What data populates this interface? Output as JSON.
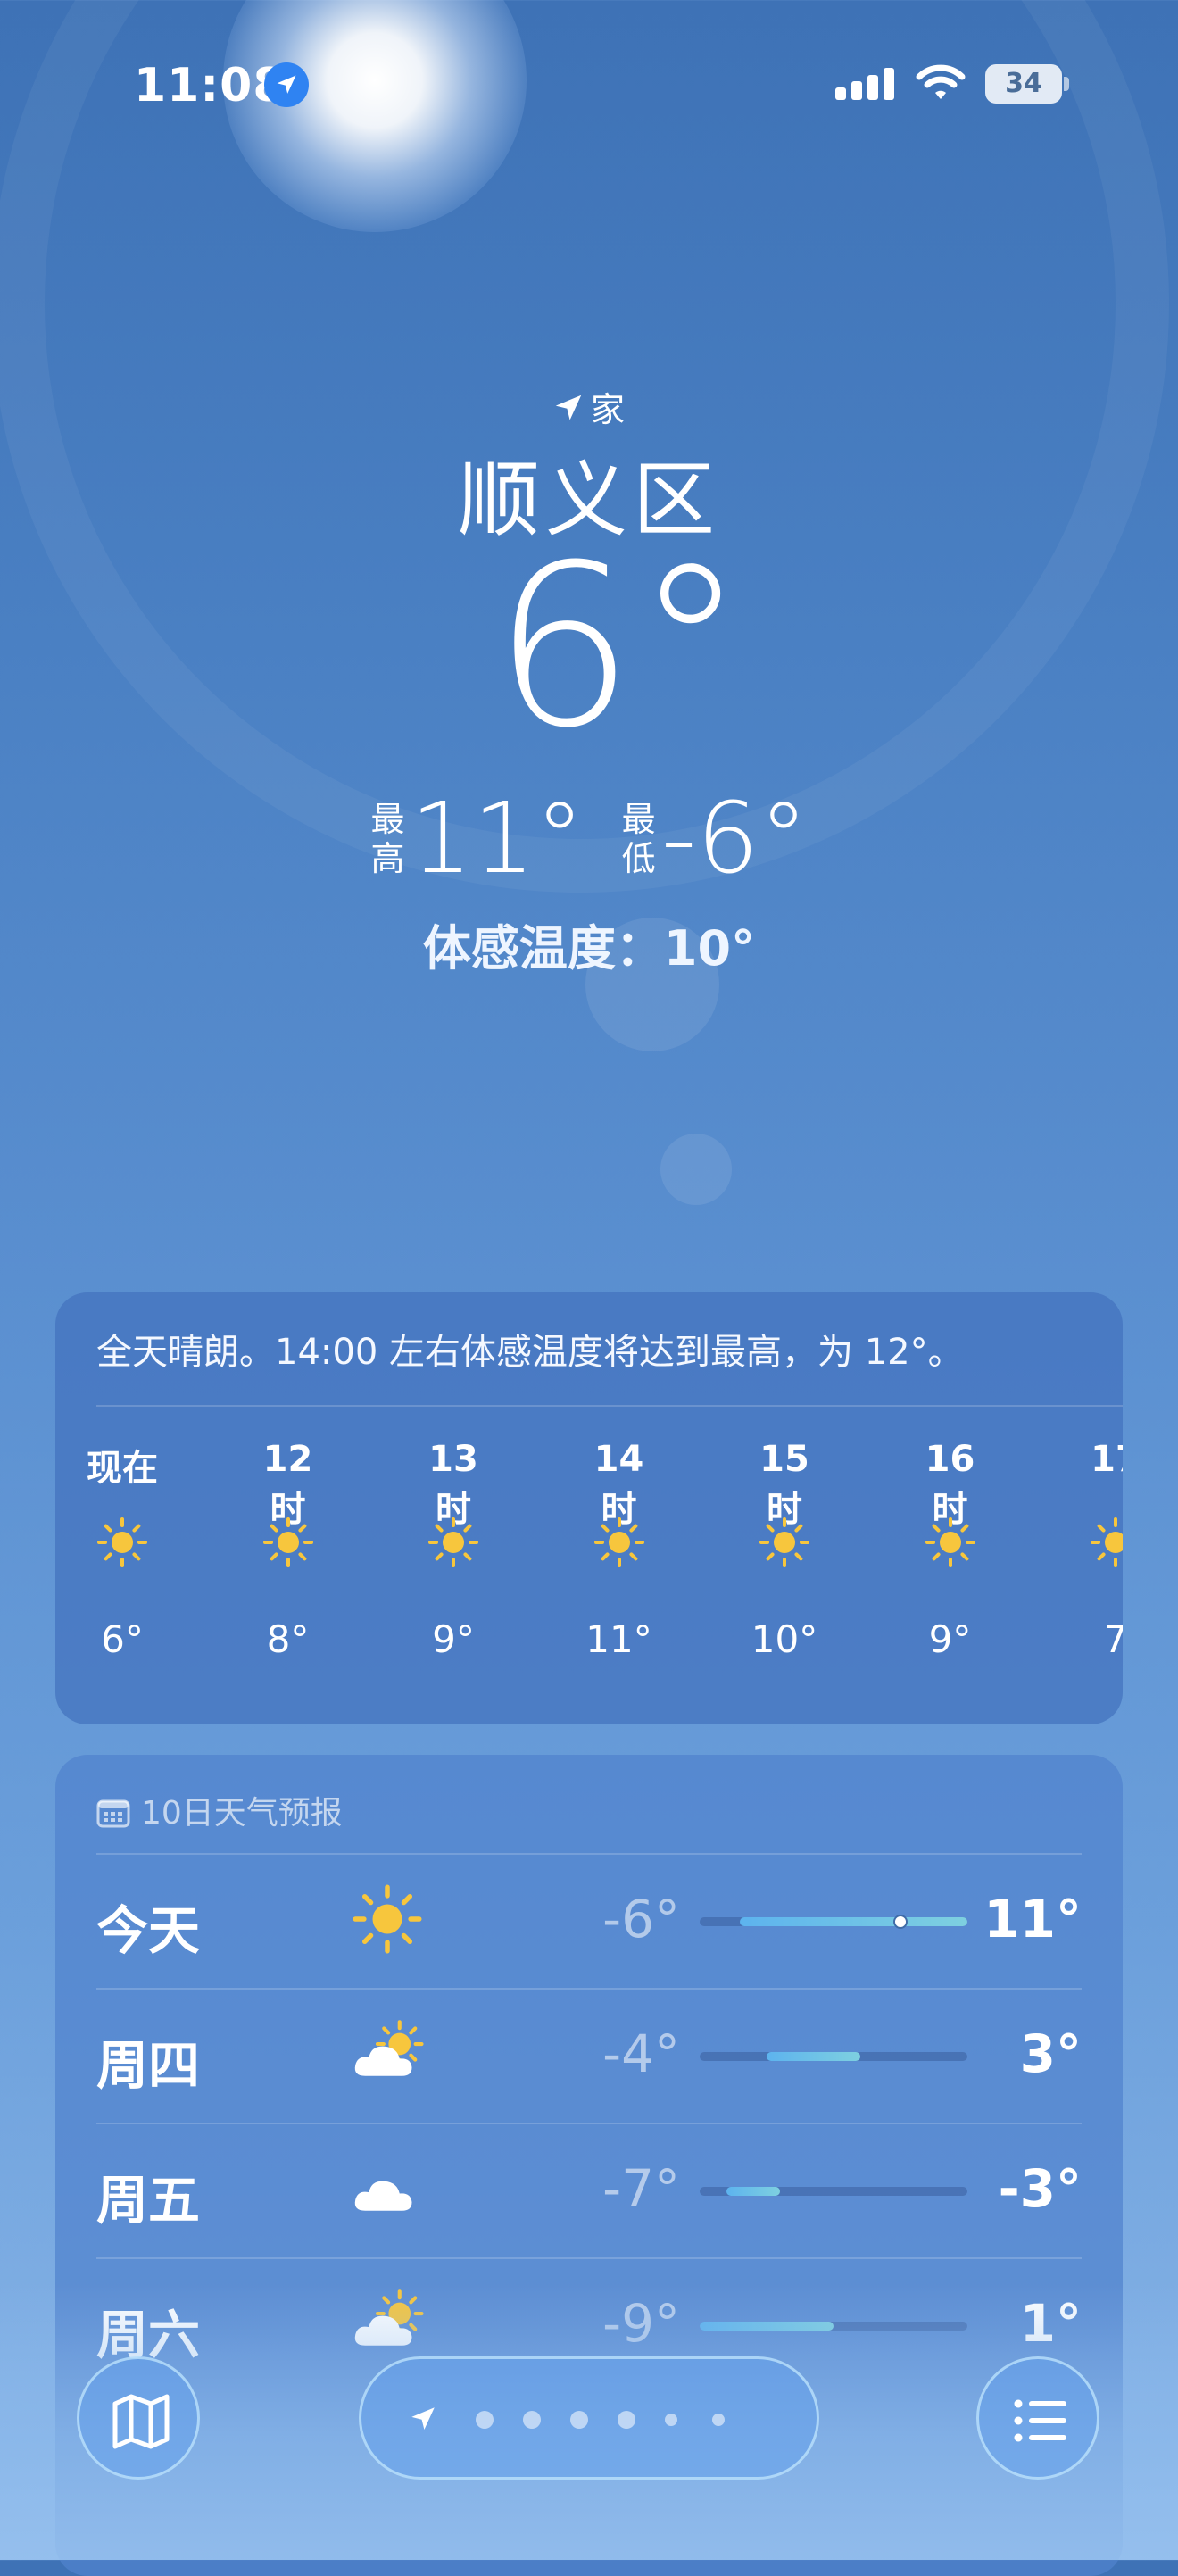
{
  "status_bar": {
    "time": "11:08",
    "battery": "34",
    "icons": [
      "location-arrow-icon",
      "cellular-signal-icon",
      "wifi-icon",
      "battery-icon"
    ]
  },
  "header": {
    "location_tag": "家",
    "city": "顺义区",
    "current_temp": "6°",
    "high_label": "最高",
    "high": "11°",
    "low_label": "最低",
    "low": "-6°",
    "feels_like": "体感温度：10°"
  },
  "hourly": {
    "summary": "全天晴朗。14:00 左右体感温度将达到最高，为 12°。",
    "items": [
      {
        "label": "现在",
        "icon": "sun-icon",
        "temp": "6°"
      },
      {
        "label": "12时",
        "icon": "sun-icon",
        "temp": "8°"
      },
      {
        "label": "13时",
        "icon": "sun-icon",
        "temp": "9°"
      },
      {
        "label": "14时",
        "icon": "sun-icon",
        "temp": "11°"
      },
      {
        "label": "15时",
        "icon": "sun-icon",
        "temp": "10°"
      },
      {
        "label": "16时",
        "icon": "sun-icon",
        "temp": "9°"
      },
      {
        "label": "17",
        "icon": "sun-icon",
        "temp": "7"
      }
    ]
  },
  "daily": {
    "title": "10日天气预报",
    "scale_min": -9,
    "scale_max": 11,
    "rows": [
      {
        "day": "今天",
        "icon": "sun-icon",
        "low": "-6°",
        "high": "11°",
        "low_value": -6,
        "high_value": 11,
        "current_value": 6
      },
      {
        "day": "周四",
        "icon": "partly-cloudy-icon",
        "low": "-4°",
        "high": "3°",
        "low_value": -4,
        "high_value": 3
      },
      {
        "day": "周五",
        "icon": "cloud-icon",
        "low": "-7°",
        "high": "-3°",
        "low_value": -7,
        "high_value": -3
      },
      {
        "day": "周六",
        "icon": "partly-cloudy-icon",
        "low": "-9°",
        "high": "1°",
        "low_value": -9,
        "high_value": 1
      }
    ]
  },
  "bottom_bar": {
    "page_count": 7,
    "current_page": 0,
    "icons": [
      "map-icon",
      "location-arrow-icon",
      "list-icon"
    ]
  },
  "colors": {
    "background_top": "#3e72b6",
    "background_bottom": "#8ab6e8",
    "sun_yellow": "#f7c63d",
    "range_bar": "#5db3ee"
  }
}
